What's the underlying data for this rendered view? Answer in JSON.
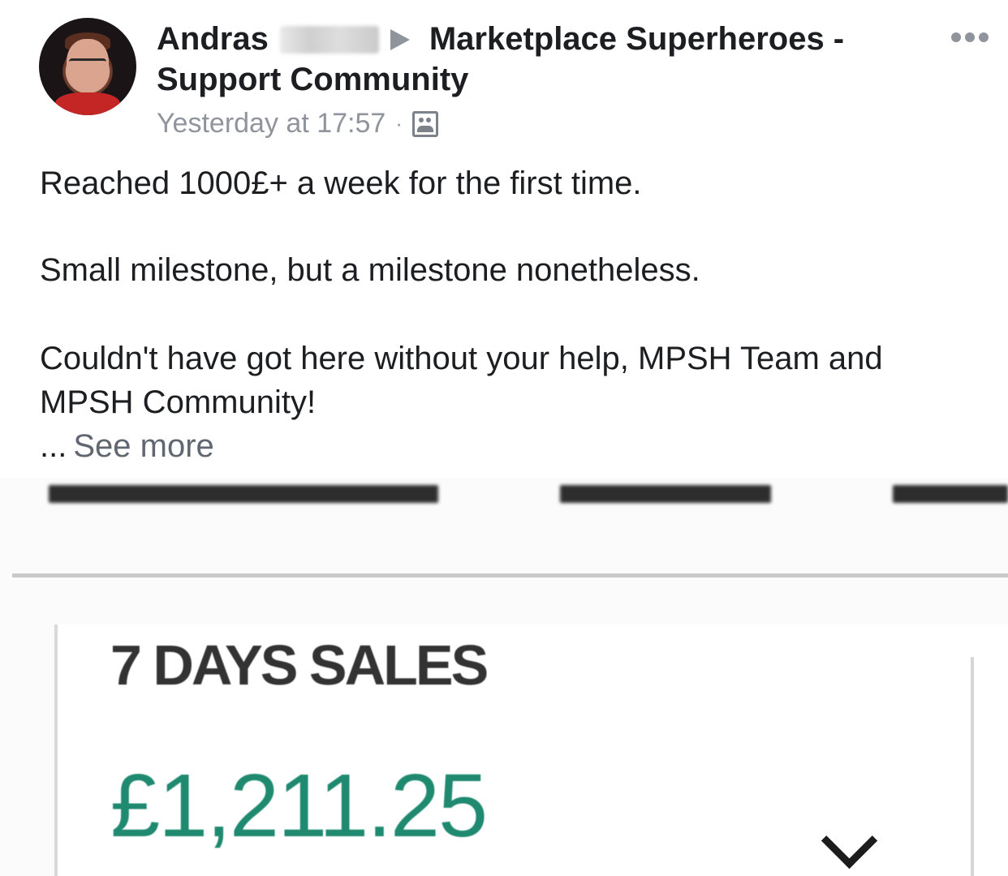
{
  "post": {
    "author_first": "Andras",
    "arrow": "▶",
    "group_line1": "Marketplace Superheroes -",
    "group_line2": "Support Community",
    "timestamp": "Yesterday at 17:57",
    "separator": "·",
    "privacy_icon": "group-icon",
    "lines": [
      "Reached 1000£+  a week for the first time.",
      "Small milestone, but a milestone nonetheless.",
      "Couldn't have got here without your help, MPSH Team and",
      "MPSH Community!"
    ],
    "ellipsis": "...",
    "see_more": "See more",
    "more_icon": "more-options-icon"
  },
  "screenshot": {
    "title": "7 DAYS SALES",
    "value": "£1,211.25",
    "value_color": "#1f8a70",
    "toggle_icon": "chevron-down-icon"
  }
}
